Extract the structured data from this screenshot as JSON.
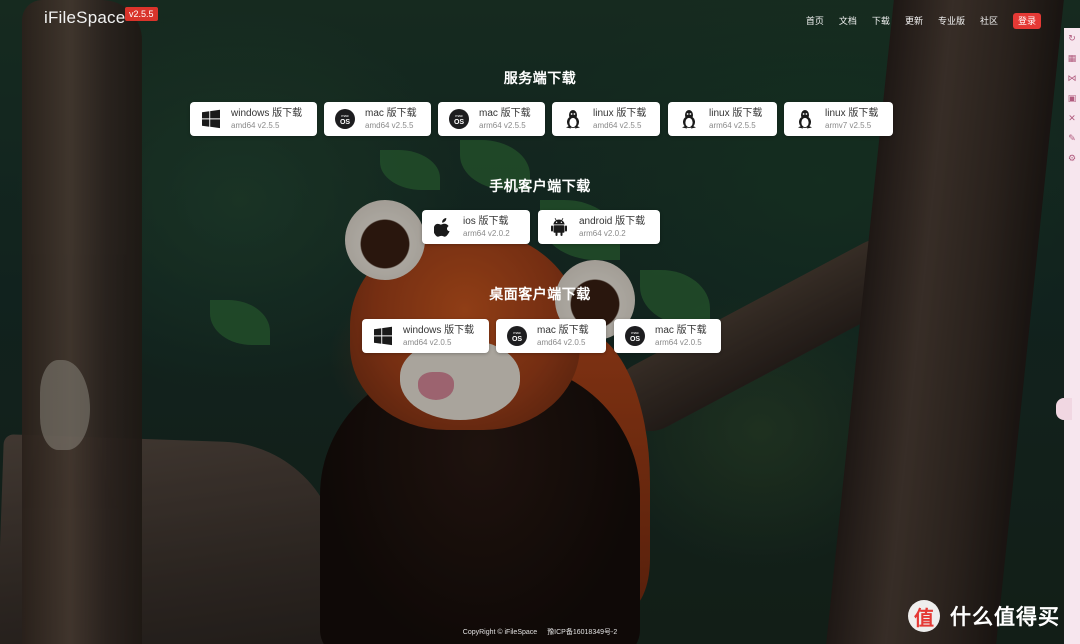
{
  "app": {
    "name": "iFileSpace",
    "version": "v2.5.5"
  },
  "nav": {
    "items": [
      "首页",
      "文档",
      "下载",
      "更新",
      "专业版",
      "社区"
    ],
    "login": "登录"
  },
  "sections": {
    "server": {
      "title": "服务端下载",
      "buttons": [
        {
          "icon": "windows-icon",
          "label": "windows 版下载",
          "sub": "amd64 v2.5.5"
        },
        {
          "icon": "macos-icon",
          "label": "mac 版下载",
          "sub": "amd64 v2.5.5"
        },
        {
          "icon": "macos-icon",
          "label": "mac 版下载",
          "sub": "arm64 v2.5.5"
        },
        {
          "icon": "linux-icon",
          "label": "linux 版下载",
          "sub": "amd64 v2.5.5"
        },
        {
          "icon": "linux-icon",
          "label": "linux 版下载",
          "sub": "arm64 v2.5.5"
        },
        {
          "icon": "linux-icon",
          "label": "linux 版下载",
          "sub": "armv7 v2.5.5"
        }
      ]
    },
    "mobile": {
      "title": "手机客户端下载",
      "buttons": [
        {
          "icon": "apple-icon",
          "label": "ios 版下载",
          "sub": "arm64 v2.0.2"
        },
        {
          "icon": "android-icon",
          "label": "android 版下载",
          "sub": "arm64 v2.0.2"
        }
      ]
    },
    "desktop": {
      "title": "桌面客户端下载",
      "buttons": [
        {
          "icon": "windows-icon",
          "label": "windows 版下载",
          "sub": "amd64 v2.0.5"
        },
        {
          "icon": "macos-icon",
          "label": "mac 版下载",
          "sub": "amd64 v2.0.5"
        },
        {
          "icon": "macos-icon",
          "label": "mac 版下载",
          "sub": "arm64 v2.0.5"
        }
      ]
    }
  },
  "mac_icon_text": {
    "top": "mac",
    "bottom": "OS"
  },
  "footer": {
    "copyright": "CopyRight © iFileSpace",
    "icp": "豫ICP备16018349号-2"
  },
  "watermark": {
    "badge": "值",
    "text": "什么值得买"
  },
  "colors": {
    "accent": "#e53935",
    "badge": "#d9342b",
    "button_bg": "#ffffff"
  }
}
